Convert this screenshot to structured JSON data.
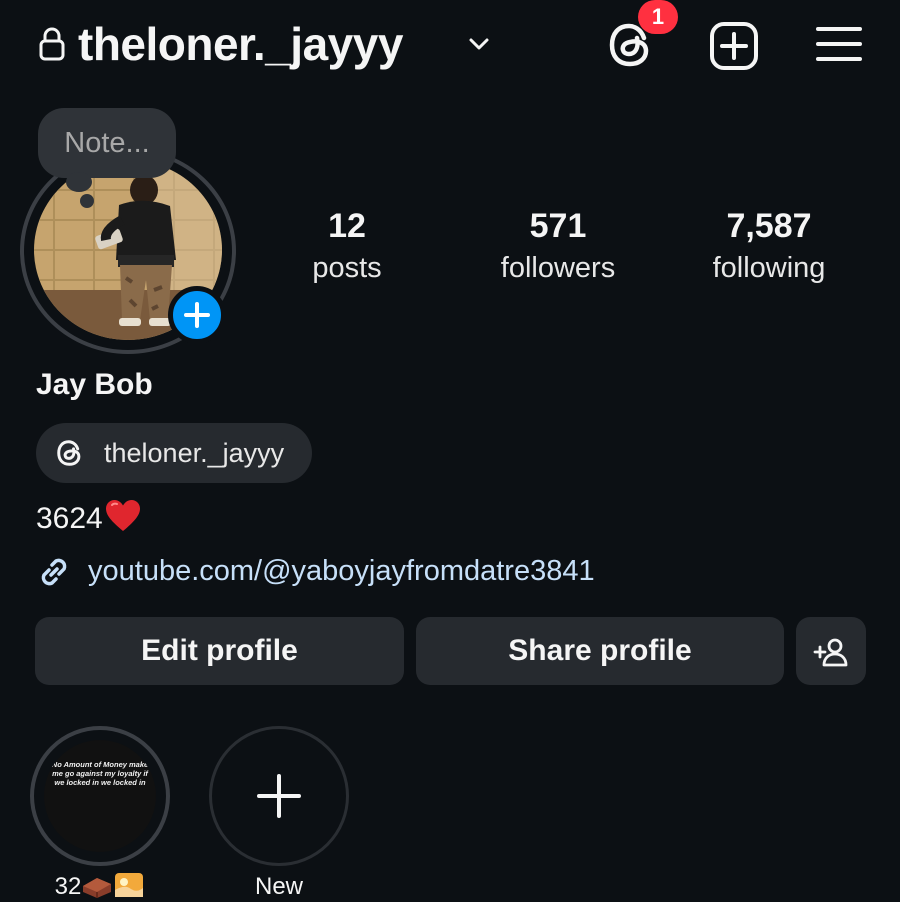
{
  "header": {
    "username": "theloner._jayyy",
    "threads_badge_count": "1",
    "icons": {
      "lock": "lock-icon",
      "chevron": "chevron-down-icon",
      "threads": "threads-icon",
      "create": "plus-square-icon",
      "menu": "hamburger-menu-icon"
    }
  },
  "profile": {
    "note_placeholder": "Note...",
    "display_name": "Jay Bob",
    "threads_handle": "theloner._jayyy",
    "bio": "3624",
    "link": "youtube.com/@yaboyjayfromdatre3841"
  },
  "stats": [
    {
      "value": "12",
      "label": "posts"
    },
    {
      "value": "571",
      "label": "followers"
    },
    {
      "value": "7,587",
      "label": "following"
    }
  ],
  "actions": {
    "edit_profile": "Edit profile",
    "share_profile": "Share profile",
    "discover_people_icon": "add-person-icon"
  },
  "highlights": [
    {
      "label": "32",
      "cover_text": "No Amount of Money make me go against my loyalty if we locked in we locked in"
    },
    {
      "label": "New"
    }
  ],
  "colors": {
    "background": "#0c1014",
    "button": "#262a2f",
    "badge": "#ff3040",
    "accent_blue": "#0095f6",
    "link": "#c7e0f9"
  }
}
